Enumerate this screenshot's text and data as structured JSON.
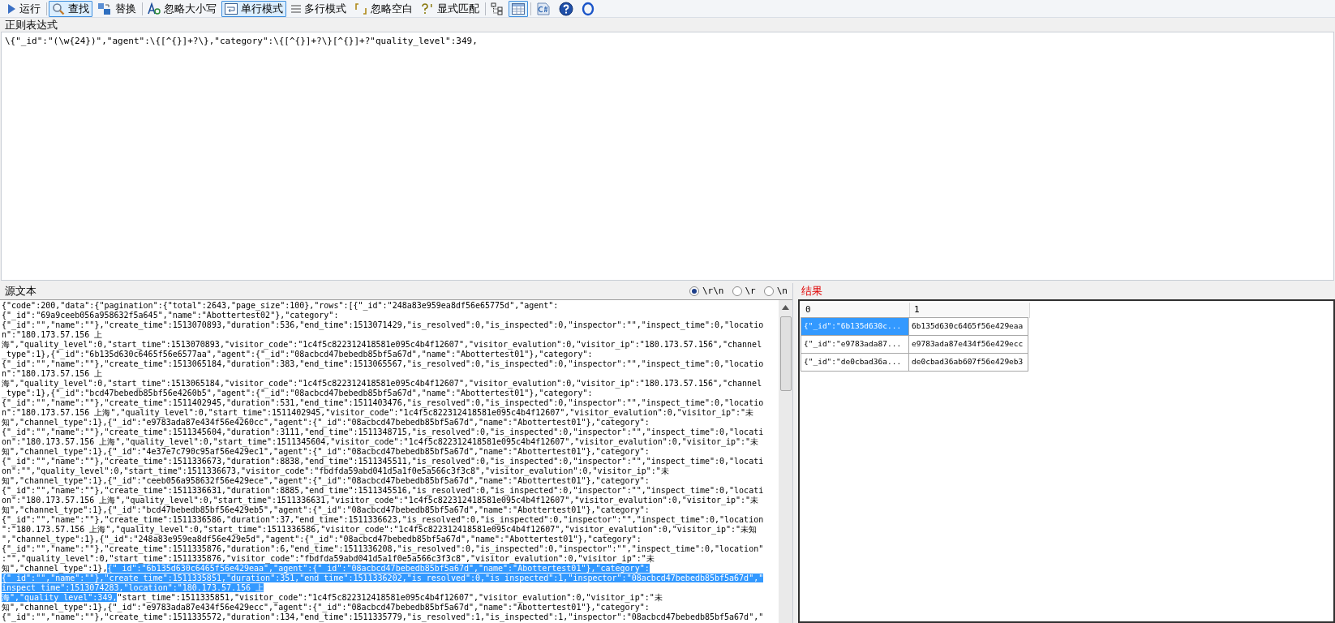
{
  "toolbar": [
    {
      "kind": "run",
      "label": "运行",
      "pressed": false
    },
    {
      "kind": "find",
      "label": "查找",
      "pressed": true
    },
    {
      "kind": "replace",
      "label": "替换",
      "pressed": false
    },
    {
      "kind": "ignore-case",
      "label": "忽略大小写",
      "pressed": false
    },
    {
      "kind": "single-line",
      "label": "单行模式",
      "pressed": true
    },
    {
      "kind": "multi-line",
      "label": "多行模式",
      "pressed": false
    },
    {
      "kind": "ignore-space",
      "label": "忽略空白",
      "pressed": false
    },
    {
      "kind": "explicit",
      "label": "显式匹配",
      "pressed": false
    },
    {
      "kind": "tree",
      "pressed": false
    },
    {
      "kind": "table",
      "pressed": true
    },
    {
      "kind": "code",
      "pressed": false
    },
    {
      "kind": "help",
      "pressed": false
    },
    {
      "kind": "ring",
      "pressed": false
    }
  ],
  "regex": {
    "label": "正则表达式",
    "value": "\\{\"_id\":\"(\\w{24})\",\"agent\":\\{[^{}]+?\\},\"category\":\\{[^{}]+?\\}[^{}]+?\"quality_level\":349,"
  },
  "source": {
    "label": "源文本",
    "line_endings": [
      {
        "label": "\\r\\n",
        "selected": true
      },
      {
        "label": "\\r",
        "selected": false
      },
      {
        "label": "\\n",
        "selected": false
      }
    ],
    "lines": [
      {
        "segments": [
          {
            "text": "{\"code\":200,\"data\":{\"pagination\":{\"total\":2643,\"page_size\":100},\"rows\":[{\"_id\":\"248a83e959ea8df56e65775d\",\"agent\":",
            "highlighted": false
          }
        ]
      },
      {
        "segments": [
          {
            "text": "{\"_id\":\"69a9ceeb056a958632f5a645\",\"name\":\"Abottertest02\"},\"category\":",
            "highlighted": false
          }
        ]
      },
      {
        "segments": [
          {
            "text": "{\"_id\":\"\",\"name\":\"\"},\"create_time\":1513070893,\"duration\":536,\"end_time\":1513071429,\"is_resolved\":0,\"is_inspected\":0,\"inspector\":\"\",\"inspect_time\":0,\"locatio",
            "highlighted": false
          }
        ]
      },
      {
        "segments": [
          {
            "text": "n\":\"180.173.57.156 上",
            "highlighted": false
          }
        ]
      },
      {
        "segments": [
          {
            "text": "海\",\"quality_level\":0,\"start_time\":1513070893,\"visitor_code\":\"1c4f5c822312418581e095c4b4f12607\",\"visitor_evalution\":0,\"visitor_ip\":\"180.173.57.156\",\"channel",
            "highlighted": false
          }
        ]
      },
      {
        "segments": [
          {
            "text": "_type\":1},{\"_id\":\"6b135d630c6465f56e6577aa\",\"agent\":{\"_id\":\"08acbcd47bebedb85bf5a67d\",\"name\":\"Abottertest01\"},\"category\":",
            "highlighted": false
          }
        ]
      },
      {
        "segments": [
          {
            "text": "{\"_id\":\"\",\"name\":\"\"},\"create_time\":1513065184,\"duration\":383,\"end_time\":1513065567,\"is_resolved\":0,\"is_inspected\":0,\"inspector\":\"\",\"inspect_time\":0,\"locatio",
            "highlighted": false
          }
        ]
      },
      {
        "segments": [
          {
            "text": "n\":\"180.173.57.156 上",
            "highlighted": false
          }
        ]
      },
      {
        "segments": [
          {
            "text": "海\",\"quality_level\":0,\"start_time\":1513065184,\"visitor_code\":\"1c4f5c822312418581e095c4b4f12607\",\"visitor_evalution\":0,\"visitor_ip\":\"180.173.57.156\",\"channel",
            "highlighted": false
          }
        ]
      },
      {
        "segments": [
          {
            "text": "_type\":1},{\"_id\":\"bcd47bebedb85bf56e4260b5\",\"agent\":{\"_id\":\"08acbcd47bebedb85bf5a67d\",\"name\":\"Abottertest01\"},\"category\":",
            "highlighted": false
          }
        ]
      },
      {
        "segments": [
          {
            "text": "{\"_id\":\"\",\"name\":\"\"},\"create_time\":1511402945,\"duration\":531,\"end_time\":1511403476,\"is_resolved\":0,\"is_inspected\":0,\"inspector\":\"\",\"inspect_time\":0,\"locatio",
            "highlighted": false
          }
        ]
      },
      {
        "segments": [
          {
            "text": "n\":\"180.173.57.156 上海\",\"quality_level\":0,\"start_time\":1511402945,\"visitor_code\":\"1c4f5c822312418581e095c4b4f12607\",\"visitor_evalution\":0,\"visitor_ip\":\"未",
            "highlighted": false
          }
        ]
      },
      {
        "segments": [
          {
            "text": "知\",\"channel_type\":1},{\"_id\":\"e9783ada87e434f56e4260cc\",\"agent\":{\"_id\":\"08acbcd47bebedb85bf5a67d\",\"name\":\"Abottertest01\"},\"category\":",
            "highlighted": false
          }
        ]
      },
      {
        "segments": [
          {
            "text": "{\"_id\":\"\",\"name\":\"\"},\"create_time\":1511345604,\"duration\":3111,\"end_time\":1511348715,\"is_resolved\":0,\"is_inspected\":0,\"inspector\":\"\",\"inspect_time\":0,\"locati",
            "highlighted": false
          }
        ]
      },
      {
        "segments": [
          {
            "text": "on\":\"180.173.57.156 上海\",\"quality_level\":0,\"start_time\":1511345604,\"visitor_code\":\"1c4f5c822312418581e095c4b4f12607\",\"visitor_evalution\":0,\"visitor_ip\":\"未",
            "highlighted": false
          }
        ]
      },
      {
        "segments": [
          {
            "text": "知\",\"channel_type\":1},{\"_id\":\"4e37e7c790c95af56e429ec1\",\"agent\":{\"_id\":\"08acbcd47bebedb85bf5a67d\",\"name\":\"Abottertest01\"},\"category\":",
            "highlighted": false
          }
        ]
      },
      {
        "segments": [
          {
            "text": "{\"_id\":\"\",\"name\":\"\"},\"create_time\":1511336673,\"duration\":8838,\"end_time\":1511345511,\"is_resolved\":0,\"is_inspected\":0,\"inspector\":\"\",\"inspect_time\":0,\"locati",
            "highlighted": false
          }
        ]
      },
      {
        "segments": [
          {
            "text": "on\":\"\",\"quality_level\":0,\"start_time\":1511336673,\"visitor_code\":\"fbdfda59abd041d5a1f0e5a566c3f3c8\",\"visitor_evalution\":0,\"visitor_ip\":\"未",
            "highlighted": false
          }
        ]
      },
      {
        "segments": [
          {
            "text": "知\",\"channel_type\":1},{\"_id\":\"ceeb056a958632f56e429ece\",\"agent\":{\"_id\":\"08acbcd47bebedb85bf5a67d\",\"name\":\"Abottertest01\"},\"category\":",
            "highlighted": false
          }
        ]
      },
      {
        "segments": [
          {
            "text": "{\"_id\":\"\",\"name\":\"\"},\"create_time\":1511336631,\"duration\":8885,\"end_time\":1511345516,\"is_resolved\":0,\"is_inspected\":0,\"inspector\":\"\",\"inspect_time\":0,\"locati",
            "highlighted": false
          }
        ]
      },
      {
        "segments": [
          {
            "text": "on\":\"180.173.57.156 上海\",\"quality_level\":0,\"start_time\":1511336631,\"visitor_code\":\"1c4f5c822312418581e095c4b4f12607\",\"visitor_evalution\":0,\"visitor_ip\":\"未",
            "highlighted": false
          }
        ]
      },
      {
        "segments": [
          {
            "text": "知\",\"channel_type\":1},{\"_id\":\"bcd47bebedb85bf56e429eb5\",\"agent\":{\"_id\":\"08acbcd47bebedb85bf5a67d\",\"name\":\"Abottertest01\"},\"category\":",
            "highlighted": false
          }
        ]
      },
      {
        "segments": [
          {
            "text": "{\"_id\":\"\",\"name\":\"\"},\"create_time\":1511336586,\"duration\":37,\"end_time\":1511336623,\"is_resolved\":0,\"is_inspected\":0,\"inspector\":\"\",\"inspect_time\":0,\"location",
            "highlighted": false
          }
        ]
      },
      {
        "segments": [
          {
            "text": "\":\"180.173.57.156 上海\",\"quality_level\":0,\"start_time\":1511336586,\"visitor_code\":\"1c4f5c822312418581e095c4b4f12607\",\"visitor_evalution\":0,\"visitor_ip\":\"未知",
            "highlighted": false
          }
        ]
      },
      {
        "segments": [
          {
            "text": "\",\"channel_type\":1},{\"_id\":\"248a83e959ea8df56e429e5d\",\"agent\":{\"_id\":\"08acbcd47bebedb85bf5a67d\",\"name\":\"Abottertest01\"},\"category\":",
            "highlighted": false
          }
        ]
      },
      {
        "segments": [
          {
            "text": "{\"_id\":\"\",\"name\":\"\"},\"create_time\":1511335876,\"duration\":6,\"end_time\":1511336208,\"is_resolved\":0,\"is_inspected\":0,\"inspector\":\"\",\"inspect_time\":0,\"location\"",
            "highlighted": false
          }
        ]
      },
      {
        "segments": [
          {
            "text": ":\"\",\"quality_level\":0,\"start_time\":1511335876,\"visitor_code\":\"fbdfda59abd041d5a1f0e5a566c3f3c8\",\"visitor_evalution\":0,\"visitor_ip\":\"未",
            "highlighted": false
          }
        ]
      },
      {
        "segments": [
          {
            "text": "知\",\"channel_type\":1},",
            "highlighted": false
          },
          {
            "text": "{\"_id\":\"6b135d630c6465f56e429eaa\",\"agent\":{\"_id\":\"08acbcd47bebedb85bf5a67d\",\"name\":\"Abottertest01\"},\"category\":",
            "highlighted": true
          }
        ]
      },
      {
        "segments": [
          {
            "text": "{\"_id\":\"\",\"name\":\"\"},\"create_time\":1511335851,\"duration\":351,\"end_time\":1511336202,\"is_resolved\":0,\"is_inspected\":1,\"inspector\":\"08acbcd47bebedb85bf5a67d\",\"",
            "highlighted": true
          }
        ]
      },
      {
        "segments": [
          {
            "text": "inspect_time\":1513074283,\"location\":\"180.173.57.156 上",
            "highlighted": true
          }
        ]
      },
      {
        "segments": [
          {
            "text": "海\",\"quality_level\":349,",
            "highlighted": true
          },
          {
            "text": "\"start_time\":1511335851,\"visitor_code\":\"1c4f5c822312418581e095c4b4f12607\",\"visitor_evalution\":0,\"visitor_ip\":\"未",
            "highlighted": false
          }
        ]
      },
      {
        "segments": [
          {
            "text": "知\",\"channel_type\":1},{\"_id\":\"e9783ada87e434f56e429ecc\",\"agent\":{\"_id\":\"08acbcd47bebedb85bf5a67d\",\"name\":\"Abottertest01\"},\"category\":",
            "highlighted": false
          }
        ]
      },
      {
        "segments": [
          {
            "text": "{\"_id\":\"\",\"name\":\"\"},\"create_time\":1511335572,\"duration\":134,\"end_time\":1511335779,\"is_resolved\":1,\"is_inspected\":1,\"inspector\":\"08acbcd47bebedb85bf5a67d\",\"",
            "highlighted": false
          }
        ]
      }
    ]
  },
  "results": {
    "label": "结果",
    "columns": [
      "0",
      "1"
    ],
    "rows": [
      {
        "cells": [
          "{\"_id\":\"6b135d630c...",
          "6b135d630c6465f56e429eaa"
        ],
        "selected": true
      },
      {
        "cells": [
          "{\"_id\":\"e9783ada87...",
          "e9783ada87e434f56e429ecc"
        ],
        "selected": false
      },
      {
        "cells": [
          "{\"_id\":\"de0cbad36a...",
          "de0cbad36ab607f56e429eb3"
        ],
        "selected": false
      }
    ]
  }
}
